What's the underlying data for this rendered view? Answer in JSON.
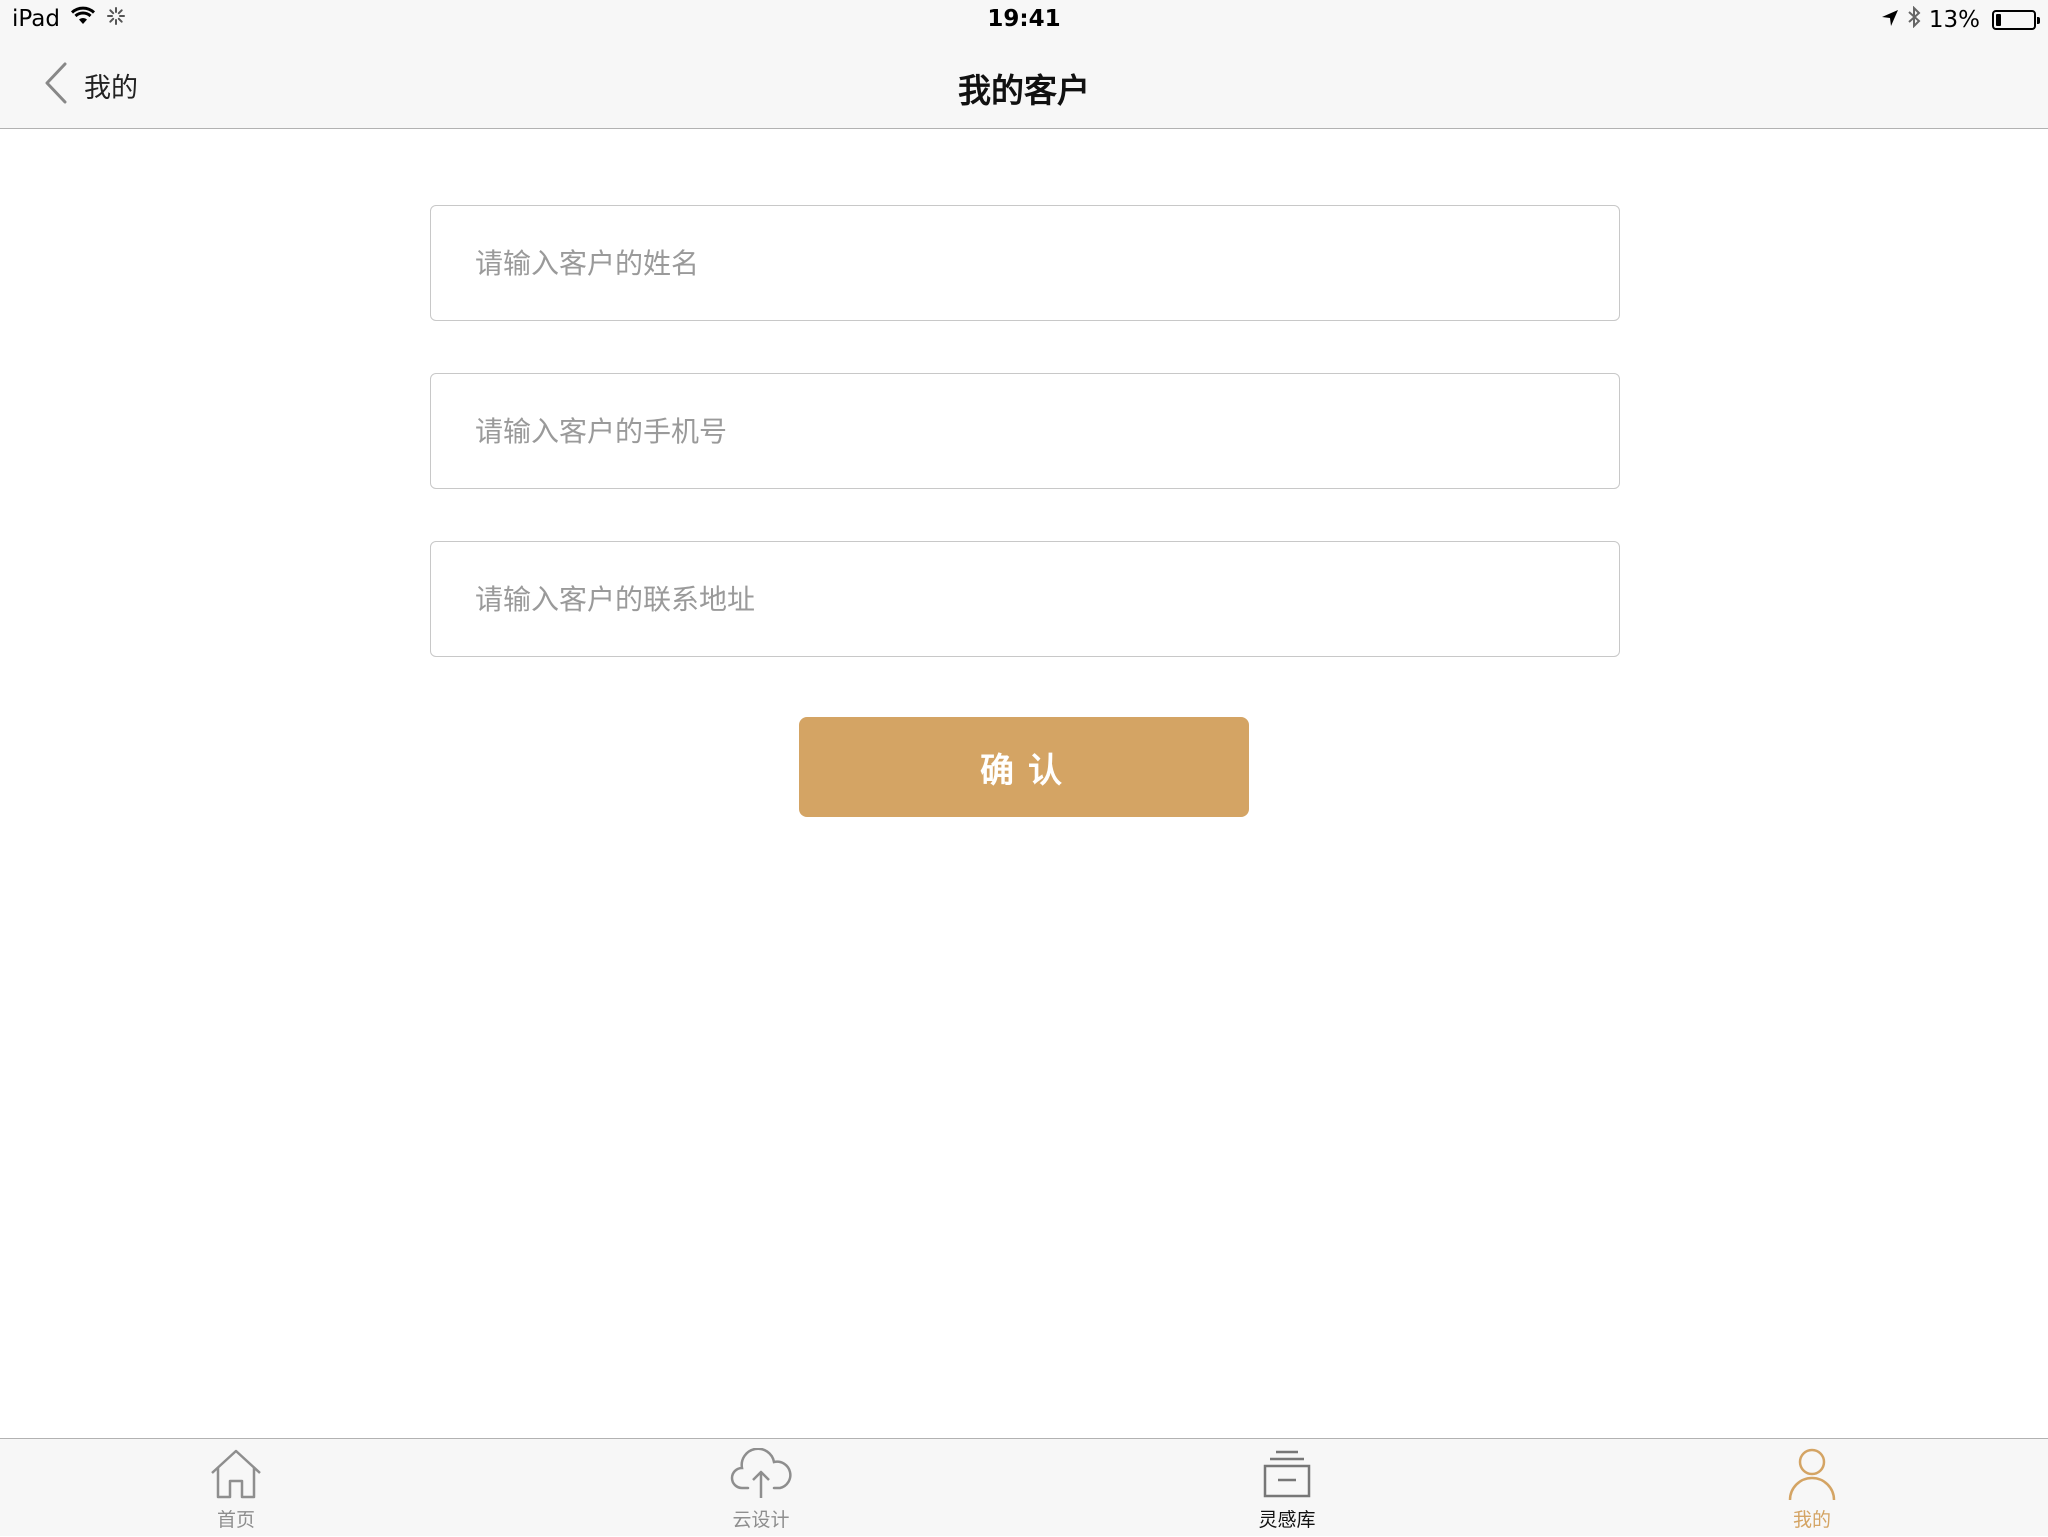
{
  "status_bar": {
    "device": "iPad",
    "time": "19:41",
    "battery_percent": "13%",
    "battery_level": 0.13
  },
  "nav": {
    "back_label": "我的",
    "title": "我的客户"
  },
  "form": {
    "name_placeholder": "请输入客户的姓名",
    "phone_placeholder": "请输入客户的手机号",
    "address_placeholder": "请输入客户的联系地址",
    "name_value": "",
    "phone_value": "",
    "address_value": "",
    "confirm_label": "确认"
  },
  "tabs": [
    {
      "label": "首页",
      "icon": "home-icon",
      "state": "inactive"
    },
    {
      "label": "云设计",
      "icon": "cloud-upload-icon",
      "state": "inactive"
    },
    {
      "label": "灵感库",
      "icon": "inspiration-box-icon",
      "state": "dark"
    },
    {
      "label": "我的",
      "icon": "person-icon",
      "state": "active"
    }
  ],
  "colors": {
    "accent": "#d4a464",
    "bar_background": "#f7f7f7",
    "inactive_tab": "#8e8e8e"
  }
}
